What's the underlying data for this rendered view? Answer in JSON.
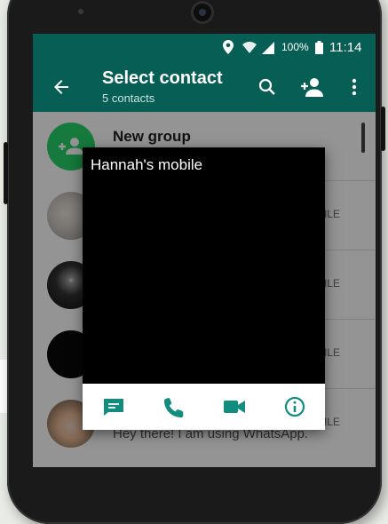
{
  "status_bar": {
    "battery": "100%",
    "time": "11:14"
  },
  "app_bar": {
    "title": "Select contact",
    "subtitle": "5 contacts"
  },
  "contacts": [
    {
      "name": "New group",
      "label": "",
      "status": ""
    },
    {
      "name": "",
      "label": "MOBILE",
      "status": ""
    },
    {
      "name": "",
      "label": "MOBILE",
      "status": ""
    },
    {
      "name": "",
      "label": "MOBILE",
      "status": ""
    },
    {
      "name": "",
      "label": "MOBILE",
      "status": "Hey there! I am using WhatsApp."
    }
  ],
  "popup": {
    "title": "Hannah's mobile"
  },
  "colors": {
    "primary": "#075e54",
    "accent": "#25d366",
    "action_icons": "#128c7e"
  },
  "icons": [
    "back-arrow",
    "search",
    "add-contact",
    "more-vert",
    "message",
    "call",
    "videocam",
    "info"
  ]
}
